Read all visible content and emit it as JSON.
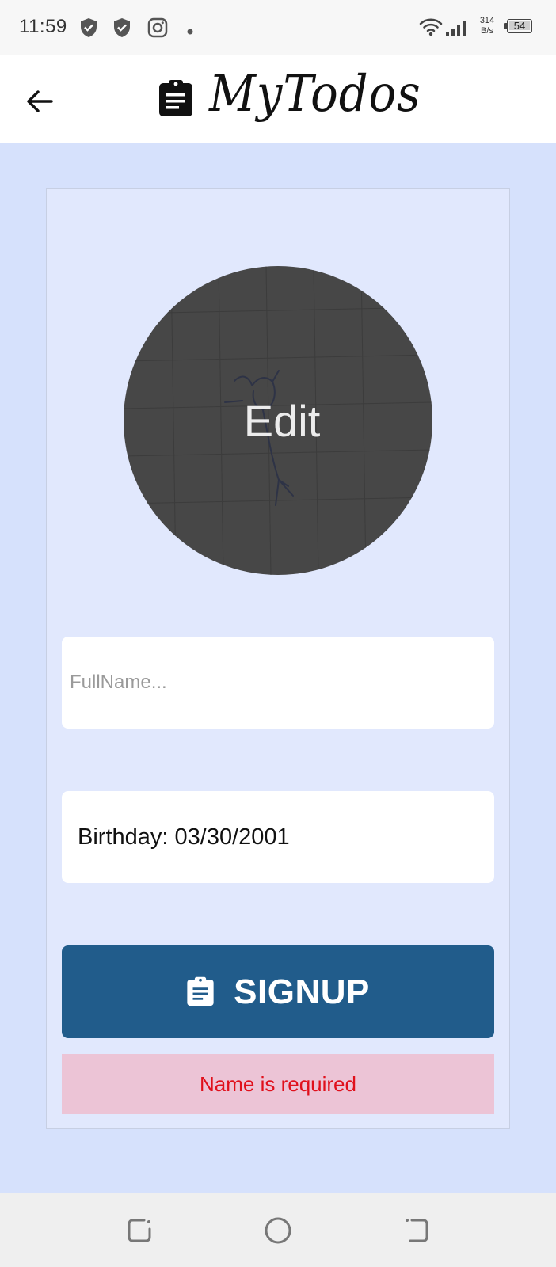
{
  "status_bar": {
    "time": "11:59",
    "net_speed_value": "314",
    "net_speed_unit": "B/s",
    "battery": "54",
    "icons": [
      "shield-check-icon",
      "shield-check-icon",
      "instagram-icon",
      "dot-icon",
      "wifi-icon",
      "signal-icon",
      "battery-icon"
    ]
  },
  "app_bar": {
    "title": "MyTodos",
    "back_icon": "arrow-left-icon",
    "logo_icon": "clipboard-icon"
  },
  "form": {
    "avatar_label": "Edit",
    "fullname_placeholder": "FullName...",
    "fullname_value": "",
    "birthday_text": "Birthday: 03/30/2001",
    "signup_label": "SIGNUP",
    "signup_icon": "clipboard-icon",
    "error_message": "Name is required"
  },
  "nav_bar": {
    "icons": [
      "recents-icon",
      "home-icon",
      "back-icon"
    ]
  },
  "colors": {
    "page_background": "#d6e1fc",
    "card_background": "#e1e8fd",
    "button": "#215c8b",
    "error_background": "#ecc4d6",
    "error_text": "#e0101c",
    "avatar": "#474747"
  }
}
